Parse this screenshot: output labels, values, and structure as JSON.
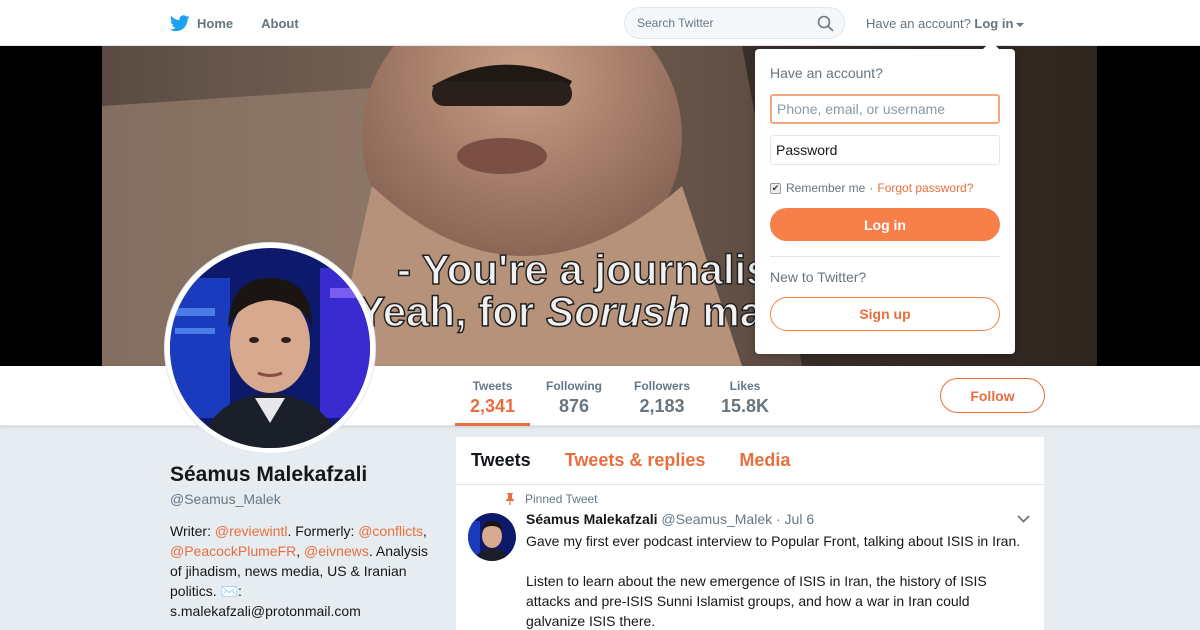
{
  "nav": {
    "home_label": "Home",
    "about_label": "About",
    "search_placeholder": "Search Twitter",
    "have_account_label": "Have an account?",
    "login_label": "Log in"
  },
  "banner": {
    "caption_line1": "- You're a journalis",
    "caption_line2_pre": "Yeah, for ",
    "caption_line2_em": "Sorush",
    "caption_line2_post": " mag"
  },
  "profile_nav": {
    "stats": [
      {
        "label": "Tweets",
        "value": "2,341"
      },
      {
        "label": "Following",
        "value": "876"
      },
      {
        "label": "Followers",
        "value": "2,183"
      },
      {
        "label": "Likes",
        "value": "15.8K"
      }
    ],
    "follow_label": "Follow"
  },
  "profile": {
    "name": "Séamus Malekafzali",
    "handle": "@Seamus_Malek",
    "bio": {
      "writer": "Writer: ",
      "link1": "@reviewintl",
      "formerly": ". Formerly: ",
      "link2": "@conflicts",
      "comma1": ",",
      "link3": "@PeacockPlumeFR",
      "comma2": ", ",
      "link4": "@eivnews",
      "rest": ". Analysis of jihadism, news media, US & Iranian politics. ",
      "mail_glyph": "✉️",
      "colon": ":",
      "email": "s.malekafzali@protonmail.com"
    }
  },
  "timeline": {
    "tabs": [
      "Tweets",
      "Tweets & replies",
      "Media"
    ],
    "pinned_label": "Pinned Tweet",
    "tweet": {
      "name": "Séamus Malekafzali",
      "handle": "@Seamus_Malek",
      "date": "· Jul 6",
      "line1": "Gave my first ever podcast interview to Popular Front, talking about ISIS in Iran.",
      "line2": "Listen to learn about the new emergence of ISIS in Iran, the history of ISIS attacks and pre-ISIS Sunni Islamist groups, and how a war in Iran could galvanize ISIS there."
    }
  },
  "login_dropdown": {
    "title": "Have an account?",
    "username_placeholder": "Phone, email, or username",
    "password_placeholder": "Password",
    "remember_label": "Remember me",
    "separator": "·",
    "forgot_label": "Forgot password?",
    "login_button": "Log in",
    "new_label": "New to Twitter?",
    "signup_button": "Sign up"
  },
  "colors": {
    "accent": "#e86f3d",
    "twitter_blue": "#1da1f2"
  }
}
